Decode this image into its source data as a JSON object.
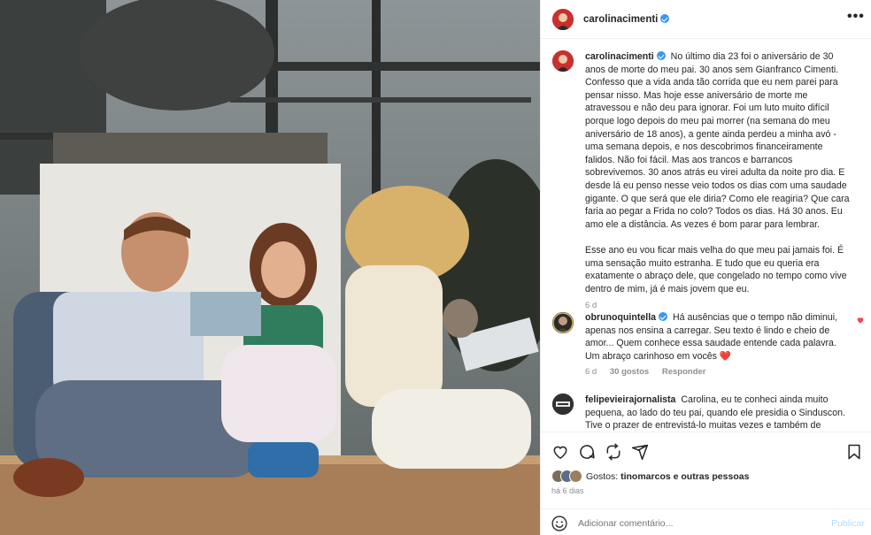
{
  "post": {
    "username": "carolinacimenti",
    "caption_paragraphs": [
      "No último dia 23 foi o aniversário de 30 anos de morte do meu pai. 30 anos sem Gianfranco Cimenti. Confesso que a vida anda tão corrida que eu nem parei para pensar nisso. Mas hoje esse aniversário de morte me atravessou e não deu para ignorar. Foi um luto muito difícil porque logo depois do meu pai morrer (na semana do meu aniversário de 18 anos), a gente ainda perdeu a minha avó - uma semana depois, e nos descobrimos financeiramente falidos. Não foi fácil. Mas aos trancos e barrancos sobrevivemos. 30 anos atrás eu virei adulta da noite pro dia. E desde lá eu penso nesse veio todos os dias com uma saudade gigante. O que será que ele diria? Como ele reagiria? Que cara faria ao pegar a Frida no colo? Todos os dias. Há 30 anos. Eu amo ele a distância. As vezes é bom parar para lembrar.",
      "Esse ano eu vou ficar mais velha do que meu pai jamais foi. É uma sensação muito estranha. E tudo que eu queria era exatamente o abraço dele, que congelado no tempo como vive dentro de mim, já é mais jovem que eu."
    ],
    "caption_time": "6 d"
  },
  "comments": [
    {
      "username": "obrunoquintella",
      "text": "Há ausências que o tempo não diminui, apenas nos ensina a carregar. Seu texto é lindo e cheio de amor... Quem conhece essa saudade entende cada palavra. Um abraço carinhoso em vocês",
      "emoji": "❤️",
      "time": "6 d",
      "likes": "30 gostos",
      "reply": "Responder"
    },
    {
      "username": "felipevieirajornalista",
      "text": "Carolina, eu te conheci ainda muito pequena, ao lado do teu pai, quando ele presidia o Sinduscon. Tive o prazer de entrevistá-lo muitas vezes e também de"
    }
  ],
  "likes_summary": {
    "prefix": "Gostos:",
    "users": "tinomarcos e outras pessoas"
  },
  "post_date": "há 6 dias",
  "add_comment": {
    "placeholder": "Adicionar comentário...",
    "publish_label": "Publicar"
  },
  "colors": {
    "verified": "#3897f0",
    "like_red": "#ed4956",
    "publish_disabled": "#b2dffc",
    "muted_text": "#8e8e8e"
  },
  "icons": [
    "more-options-icon",
    "heart-icon",
    "comment-icon",
    "share-icon",
    "send-icon",
    "bookmark-icon",
    "smile-emoji-icon"
  ]
}
